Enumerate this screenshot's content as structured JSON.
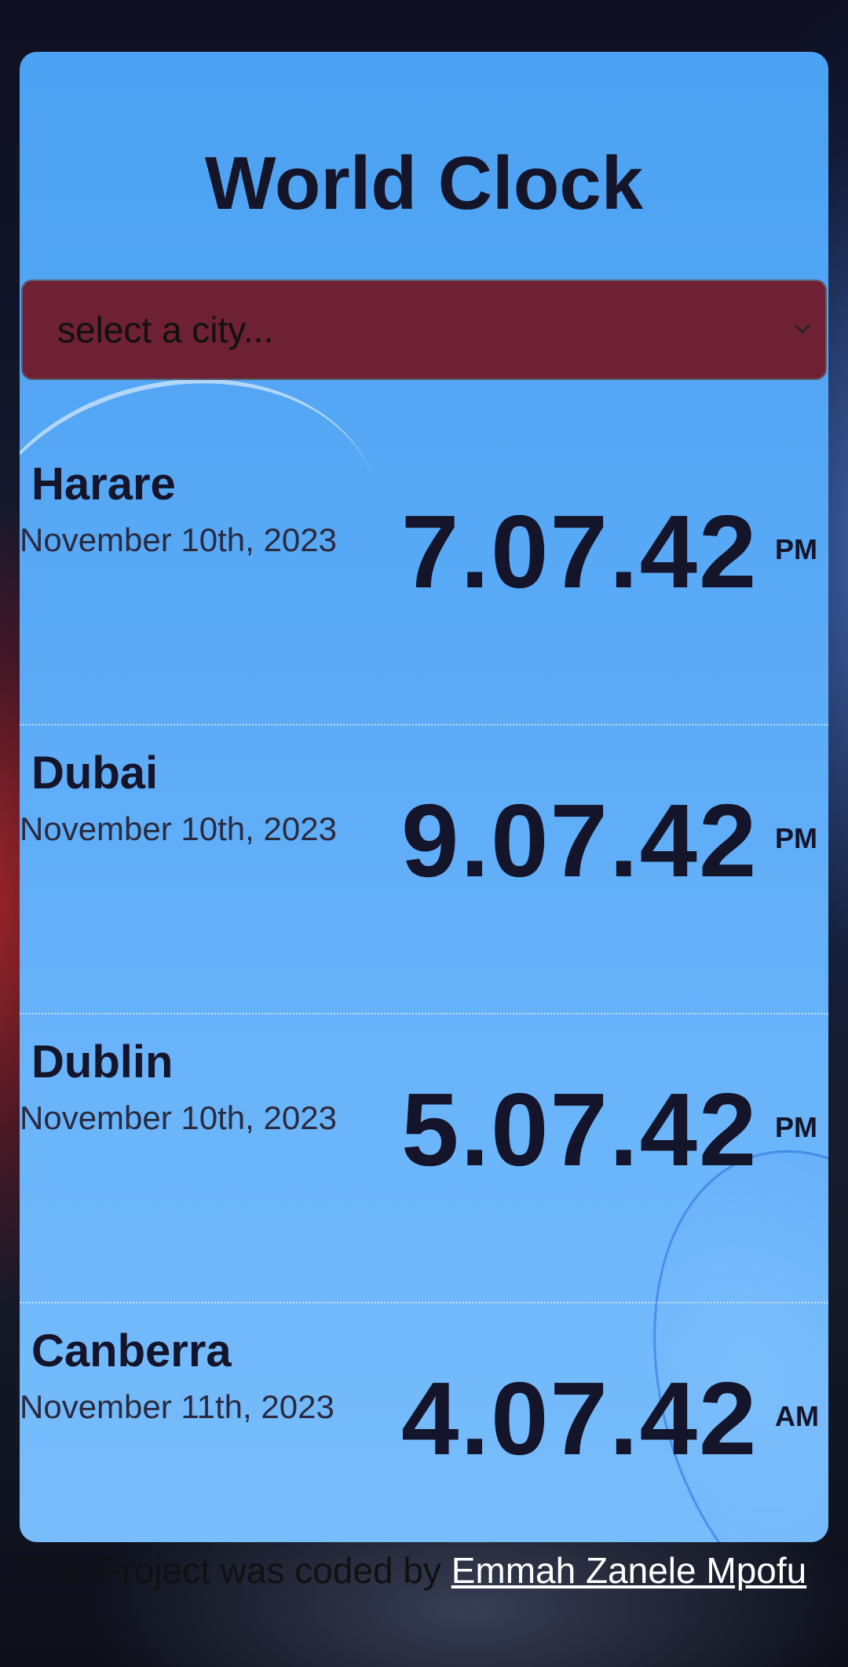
{
  "app": {
    "title": "World Clock"
  },
  "city_select": {
    "selected_label": "select a city..."
  },
  "cities": [
    {
      "name": "Harare",
      "date": "November 10th, 2023",
      "time": "7.07.42",
      "ampm": "PM"
    },
    {
      "name": "Dubai",
      "date": "November 10th, 2023",
      "time": "9.07.42",
      "ampm": "PM"
    },
    {
      "name": "Dublin",
      "date": "November 10th, 2023",
      "time": "5.07.42",
      "ampm": "PM"
    },
    {
      "name": "Canberra",
      "date": "November 11th, 2023",
      "time": "4.07.42",
      "ampm": "AM"
    }
  ],
  "footer": {
    "text": "This Project was coded by ",
    "author_link": "Emmah Zanele Mpofu"
  },
  "colors": {
    "card": "#5aaaf6",
    "select_background": "#6e2133",
    "text_dark": "#14142a",
    "link": "#ffffff"
  },
  "icons": {
    "select_arrow": "chevron-down-icon"
  }
}
